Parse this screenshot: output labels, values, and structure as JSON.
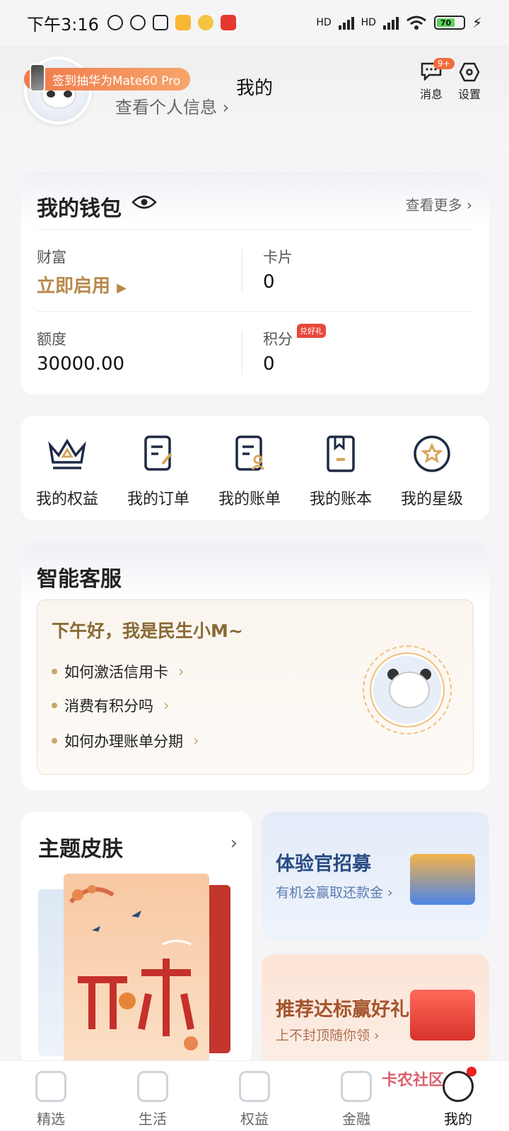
{
  "status": {
    "time": "下午3:16",
    "network1": "HD",
    "network2": "HD",
    "battery": "70"
  },
  "header": {
    "title": "我的",
    "profile_link": "查看个人信息 ›",
    "promo_pill": "签到抽华为Mate60 Pro",
    "messages_label": "消息",
    "messages_badge": "9+",
    "settings_label": "设置"
  },
  "wallet": {
    "title": "我的钱包",
    "more": "查看更多 ›",
    "items": [
      {
        "label": "财富",
        "value": "立即启用"
      },
      {
        "label": "卡片",
        "value": "0"
      },
      {
        "label": "额度",
        "value": "30000.00"
      },
      {
        "label": "积分",
        "value": "0",
        "tag": "兑好礼"
      }
    ]
  },
  "shortcuts": [
    {
      "label": "我的权益",
      "icon": "crown-icon"
    },
    {
      "label": "我的订单",
      "icon": "order-icon"
    },
    {
      "label": "我的账单",
      "icon": "bill-icon"
    },
    {
      "label": "我的账本",
      "icon": "ledger-icon"
    },
    {
      "label": "我的星级",
      "icon": "star-level-icon"
    }
  ],
  "service": {
    "title": "智能客服",
    "greeting": "下午好，我是民生小M~",
    "faqs": [
      "如何激活信用卡",
      "消费有积分吗",
      "如何办理账单分期"
    ]
  },
  "skin": {
    "title": "主题皮肤",
    "arrow": "›"
  },
  "promos": [
    {
      "title": "体验官招募",
      "subtitle": "有机会赢取还款金 ›"
    },
    {
      "title": "推荐达标赢好礼",
      "subtitle": "上不封顶随你领 ›"
    }
  ],
  "tabs": [
    "精选",
    "生活",
    "权益",
    "金融",
    "我的"
  ],
  "watermark": "卡农社区",
  "colors": {
    "accent_gold": "#b8884a",
    "promo_orange": "#f07a4a",
    "badge_red": "#e8483b"
  }
}
